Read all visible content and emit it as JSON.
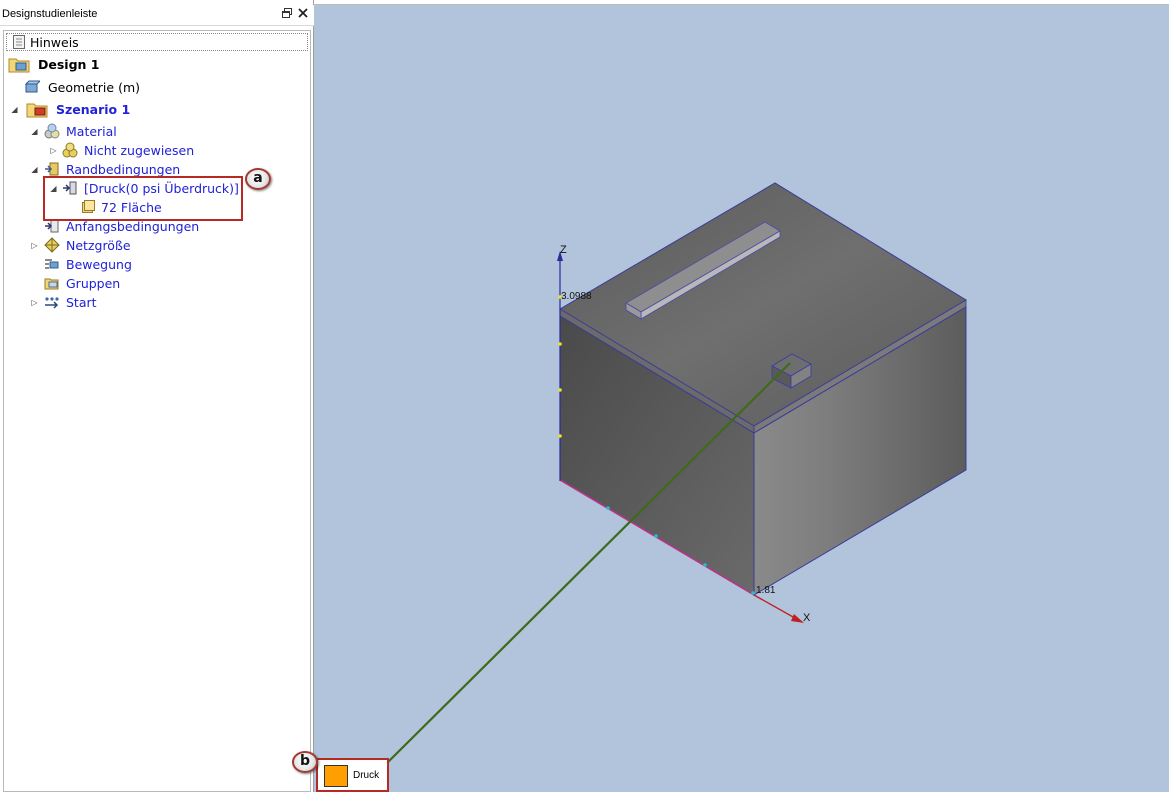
{
  "panel": {
    "title": "Designstudienleiste",
    "restore_icon": "restore-window-icon",
    "close_icon": "close-icon"
  },
  "tree": {
    "hinweis": "Hinweis",
    "design": "Design 1",
    "geometrie": "Geometrie (m)",
    "szenario": "Szenario 1",
    "material": "Material",
    "nicht_zugewiesen": "Nicht zugewiesen",
    "randbedingungen": "Randbedingungen",
    "druck": "[Druck(0 psi Überdruck)]",
    "flaeche": "72 Fläche",
    "anfangsbedingungen": "Anfangsbedingungen",
    "netzgroesse": "Netzgröße",
    "bewegung": "Bewegung",
    "gruppen": "Gruppen",
    "start": "Start"
  },
  "callouts": {
    "a": "a",
    "b": "b"
  },
  "viewport": {
    "axis_z": "Z",
    "axis_x": "X",
    "z_value": "3.0988",
    "x_value": "1.81",
    "legend_label": "Druck",
    "legend_color": "#ffa000",
    "background_color": "#b1c4dc"
  }
}
